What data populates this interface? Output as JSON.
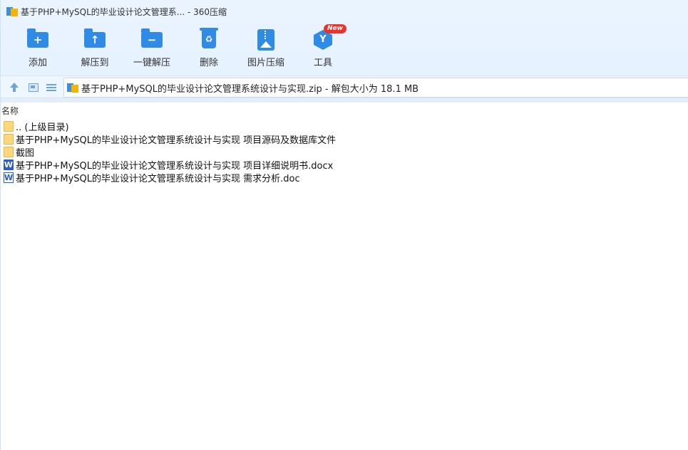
{
  "window": {
    "title": "基于PHP+MySQL的毕业设计论文管理系... - 360压缩"
  },
  "toolbar": {
    "items": [
      {
        "label": "添加",
        "icon": "add-icon"
      },
      {
        "label": "解压到",
        "icon": "extract-to-icon"
      },
      {
        "label": "一键解压",
        "icon": "one-click-extract-icon"
      },
      {
        "label": "删除",
        "icon": "delete-icon"
      },
      {
        "label": "图片压缩",
        "icon": "image-compress-icon"
      },
      {
        "label": "工具",
        "icon": "tools-icon",
        "badge": "New"
      }
    ]
  },
  "address": {
    "text": "基于PHP+MySQL的毕业设计论文管理系统设计与实现.zip - 解包大小为 18.1 MB"
  },
  "list": {
    "header_name": "名称",
    "rows": [
      {
        "name": ".. (上级目录)",
        "type": "folder"
      },
      {
        "name": "基于PHP+MySQL的毕业设计论文管理系统设计与实现 项目源码及数据库文件",
        "type": "folder"
      },
      {
        "name": "截图",
        "type": "folder"
      },
      {
        "name": "基于PHP+MySQL的毕业设计论文管理系统设计与实现 项目详细说明书.docx",
        "type": "docx"
      },
      {
        "name": "基于PHP+MySQL的毕业设计论文管理系统设计与实现 需求分析.doc",
        "type": "doc"
      }
    ]
  },
  "colors": {
    "accent": "#2f8be6",
    "header_bg": "#eaf4ff",
    "badge": "#e8342b",
    "folder": "#ffd77a",
    "word": "#2b5cce"
  }
}
